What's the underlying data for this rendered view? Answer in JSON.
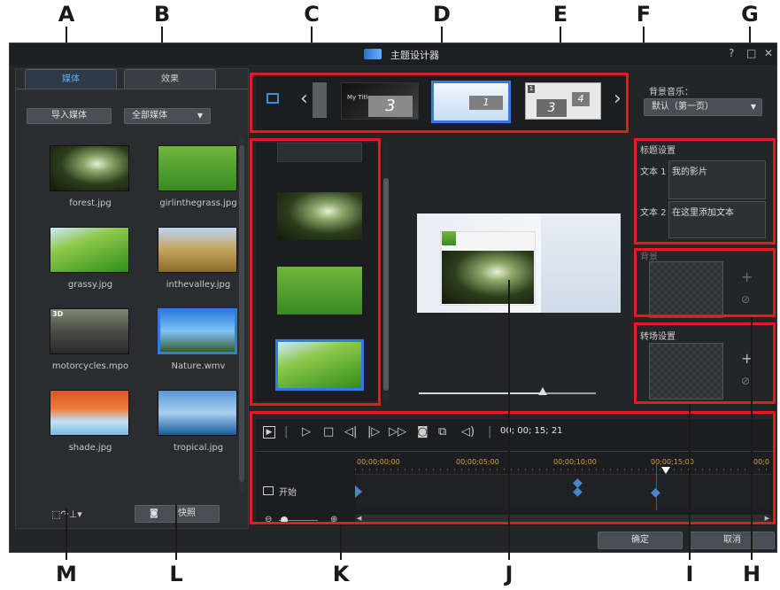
{
  "callouts": {
    "top": [
      "A",
      "B",
      "C",
      "D",
      "E",
      "F",
      "G"
    ],
    "bottom": [
      "M",
      "L",
      "K",
      "J",
      "I",
      "H"
    ]
  },
  "window": {
    "title": "主题设计器",
    "help": "?",
    "maximize": "□",
    "close": "✕"
  },
  "left_panel": {
    "tabs": [
      "媒体",
      "效果"
    ],
    "import_button": "导入媒体",
    "filter_dropdown": "全部媒体",
    "media": [
      {
        "name": "forest.jpg",
        "style": "img-forest"
      },
      {
        "name": "girlinthegrass.jpg",
        "style": "img-girl"
      },
      {
        "name": "grassy.jpg",
        "style": "img-grassy"
      },
      {
        "name": "inthevalley.jpg",
        "style": "img-valley"
      },
      {
        "name": "motorcycles.mpo",
        "style": "img-moto",
        "badge": "3D"
      },
      {
        "name": "Nature.wmv",
        "style": "img-nature"
      },
      {
        "name": "shade.jpg",
        "style": "img-shade"
      },
      {
        "name": "tropical.jpg",
        "style": "img-tropical"
      }
    ],
    "snapshot_button": "快照"
  },
  "template_strip": {
    "thumbs": [
      {
        "label": "3"
      },
      {
        "label": "1"
      },
      {
        "label": "3",
        "label2": "4",
        "label3": "1"
      }
    ],
    "my_title": "My Title"
  },
  "bg_music": {
    "label": "背景音乐：",
    "value": "默认（第一页）"
  },
  "title_settings": {
    "header": "标题设置",
    "text1_label": "文本 1",
    "text1_value": "我的影片",
    "text2_label": "文本 2",
    "text2_value": "在这里添加文本"
  },
  "background": {
    "header": "背景"
  },
  "transition": {
    "header": "转场设置"
  },
  "preview": {
    "slider_value": 0.7
  },
  "timeline": {
    "timecode": "00; 00; 15; 21",
    "ruler": [
      "00;00;00;00",
      "00;00;05;00",
      "00;00;10;00",
      "00;00;15;00",
      "00;0"
    ],
    "track_label": "开始"
  },
  "footer": {
    "ok": "确定",
    "cancel": "取消"
  },
  "colors": {
    "accent_blue": "#2f7de0",
    "callout_red": "#e31b23",
    "timeline_orange": "#d4a23a"
  }
}
